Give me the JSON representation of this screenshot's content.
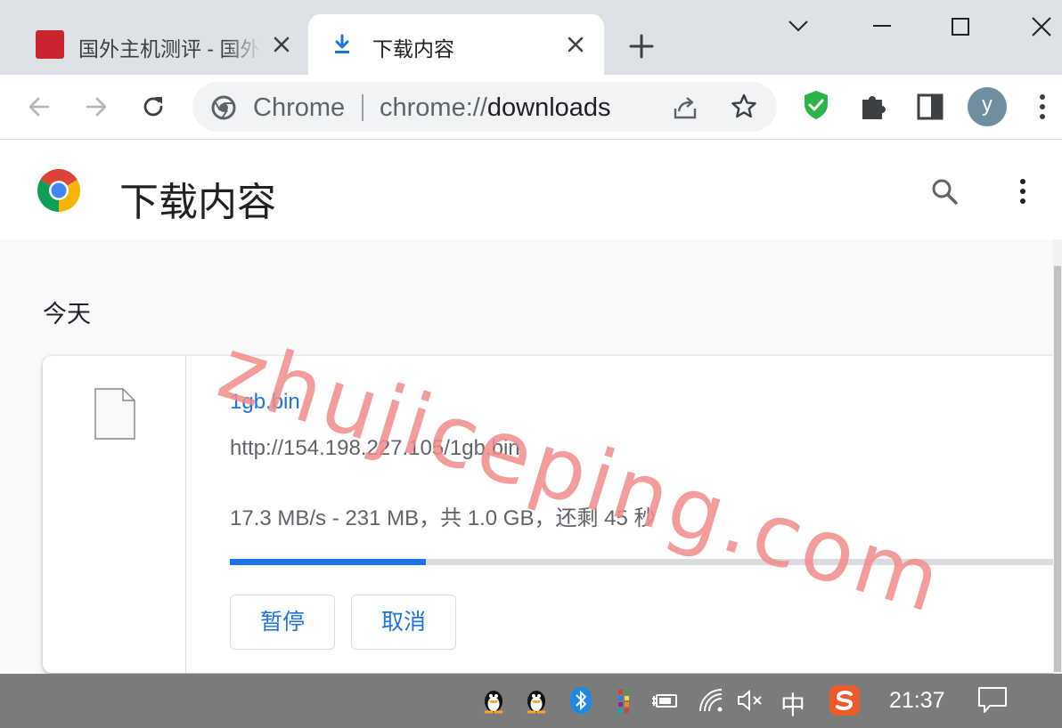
{
  "tabs": [
    {
      "title": "国外主机测评 - 国外VPS"
    },
    {
      "title": "下载内容"
    }
  ],
  "omnibox": {
    "site_label": "Chrome",
    "url_scheme": "chrome://",
    "url_host": "downloads"
  },
  "profile": {
    "initial": "y"
  },
  "page": {
    "title": "下载内容"
  },
  "downloads": {
    "date_heading": "今天",
    "items": [
      {
        "file_name": "1gb.bin",
        "url": "http://154.198.227.105/1gb.bin",
        "status": "17.3 MB/s - 231 MB，共 1.0 GB，还剩 45 秒",
        "progress": 0.238,
        "pause_label": "暂停",
        "cancel_label": "取消"
      }
    ]
  },
  "watermark": {
    "text": "zhujiceping.com"
  },
  "taskbar": {
    "ime": "中",
    "clock": "21:37"
  },
  "colors": {
    "accent": "#1a73e8",
    "tabstrip": "#dee1e6",
    "taskbar": "#7a7b7b",
    "watermark": "#f28b8b"
  }
}
